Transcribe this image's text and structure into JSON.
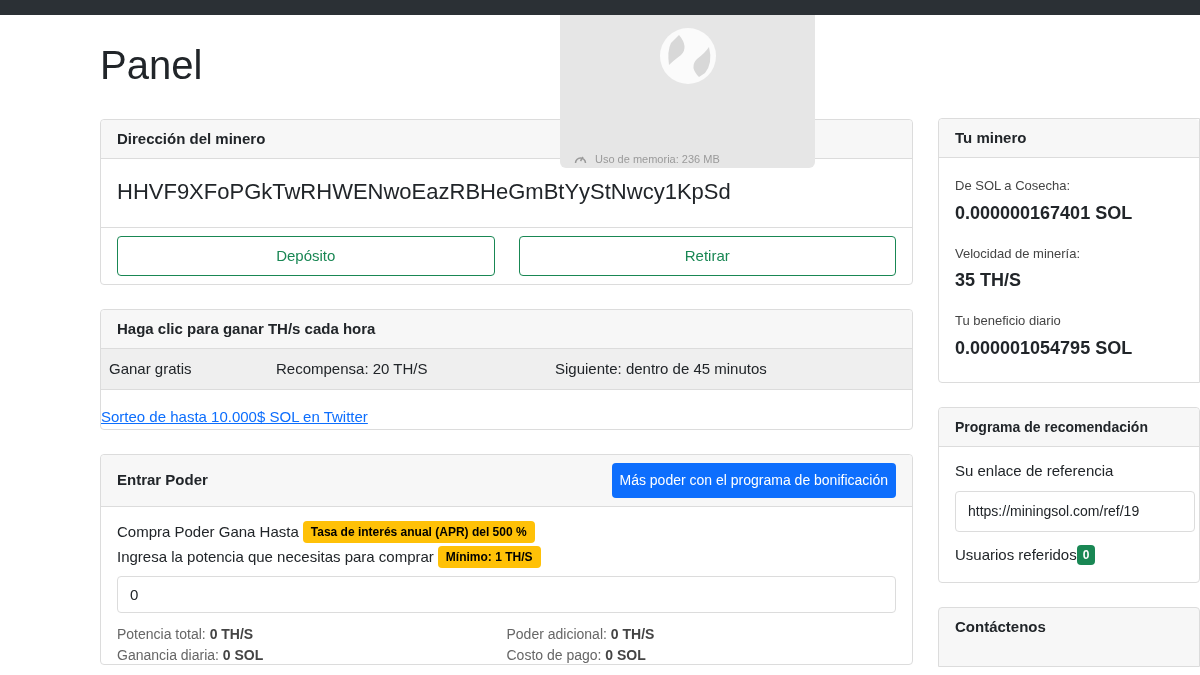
{
  "page_title": "Panel",
  "miner_address": {
    "title": "Dirección del minero",
    "address": "HHVF9XFoPGkTwRHWENwoEazRBHeGmBtYyStNwcy1KpSd",
    "buttons": [
      "Depósito",
      "Retirar"
    ]
  },
  "hourly": {
    "title": "Haga clic para ganar TH/s cada hora",
    "row": [
      "Ganar gratis",
      "Recompensa: 20 TH/S",
      "Siguiente: dentro de 45 minutos"
    ],
    "link": "Sorteo de hasta 10.000$ SOL en Twitter"
  },
  "power": {
    "title": "Entrar Poder",
    "bonus_button": "Más poder con el programa de bonificación",
    "line1": "Compra Poder Gana Hasta",
    "line1_badge": "Tasa de interés anual (APR) del 500 %",
    "line2": "Ingresa la potencia que necesitas para comprar",
    "line2_badge": "Mínimo: 1 TH/S",
    "input_value": "0",
    "stats": [
      {
        "label": "Potencia total:",
        "value": "0 TH/S"
      },
      {
        "label": "Poder adicional:",
        "value": "0 TH/S"
      },
      {
        "label": "Ganancia diaria:",
        "value": "0 SOL"
      },
      {
        "label": "Costo de pago:",
        "value": "0 SOL"
      }
    ]
  },
  "your_miner": {
    "title": "Tu minero",
    "items": [
      {
        "label": "De SOL a Cosecha:",
        "value": "0.000000167401 SOL"
      },
      {
        "label": "Velocidad de minería:",
        "value": "35 TH/S"
      },
      {
        "label": "Tu beneficio diario",
        "value": "0.000001054795 SOL"
      }
    ]
  },
  "referral": {
    "title": "Programa de recomendación",
    "link_label": "Su enlace de referencia",
    "link_value": "https://miningsol.com/ref/19",
    "referred_label": "Usuarios referidos",
    "referred_count": "0"
  },
  "contact": {
    "title": "Contáctenos"
  },
  "memory_popup": {
    "text": "Uso de memoria: 236 MB"
  }
}
